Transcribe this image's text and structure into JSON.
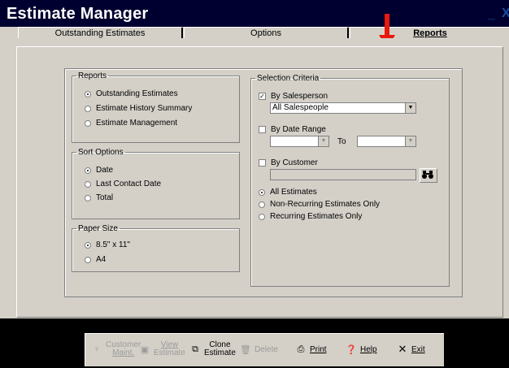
{
  "app": {
    "title": "Estimate Manager"
  },
  "window": {
    "minimize": "_",
    "close": "X"
  },
  "tabs": [
    {
      "label": "Outstanding Estimates",
      "active": false
    },
    {
      "label": "Options",
      "active": false
    },
    {
      "label": "Reports",
      "active": true
    }
  ],
  "reports": {
    "legend": "Reports",
    "options": [
      "Outstanding Estimates",
      "Estimate History Summary",
      "Estimate Management"
    ],
    "selected": 0
  },
  "sort": {
    "legend": "Sort Options",
    "options": [
      "Date",
      "Last Contact Date",
      "Total"
    ],
    "selected": 0
  },
  "paper": {
    "legend": "Paper Size",
    "options": [
      "8.5\" x 11\"",
      "A4"
    ],
    "selected": 0
  },
  "criteria": {
    "legend": "Selection Criteria",
    "by_salesperson": {
      "label": "By Salesperson",
      "checked": true,
      "value": "All Salespeople"
    },
    "by_date": {
      "label": "By Date Range",
      "checked": false,
      "to_label": "To"
    },
    "by_customer": {
      "label": "By Customer",
      "checked": false
    },
    "estimate_filter": {
      "options": [
        "All Estimates",
        "Non-Recurring Estimates Only",
        "Recurring Estimates Only"
      ],
      "selected": 0
    }
  },
  "toolbar": {
    "customer_maint": [
      "Customer",
      "Maint."
    ],
    "view_estimate": [
      "View",
      "Estimate"
    ],
    "clone_estimate": [
      "Clone",
      "Estimate"
    ],
    "delete": "Delete",
    "print": "Print",
    "help": "Help",
    "exit": "Exit"
  },
  "colors": {
    "titlebar": "#000030",
    "panel": "#d4d0c8",
    "annotation_arrow": "#e8190e"
  }
}
